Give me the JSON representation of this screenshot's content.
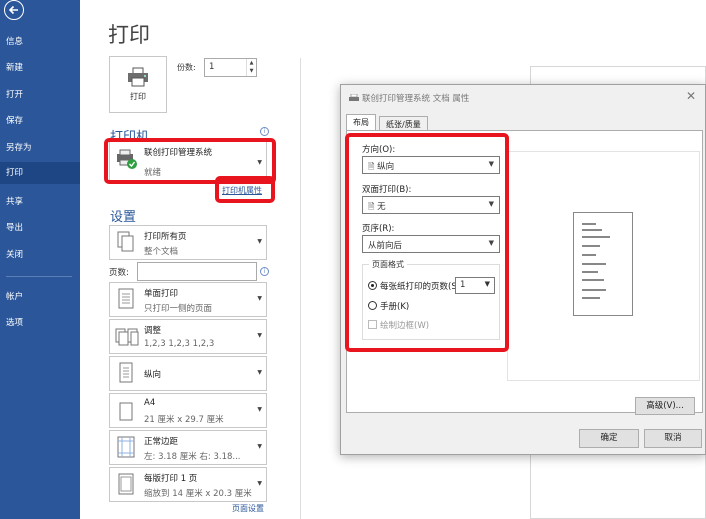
{
  "nav": {
    "items": [
      "信息",
      "新建",
      "打开",
      "保存",
      "另存为",
      "打印",
      "共享",
      "导出",
      "关闭",
      "帐户",
      "选项"
    ],
    "active": "打印"
  },
  "page": {
    "title": "打印"
  },
  "print_button": {
    "label": "打印"
  },
  "copies": {
    "label": "份数:",
    "value": "1"
  },
  "printer": {
    "heading": "打印机",
    "name": "联创打印管理系统",
    "status": "就绪",
    "properties_link": "打印机属性"
  },
  "settings": {
    "heading": "设置",
    "pages_label": "页数:",
    "pages_value": "",
    "items": [
      {
        "main": "打印所有页",
        "sub": "整个文档"
      },
      {
        "main": "单面打印",
        "sub": "只打印一侧的页面"
      },
      {
        "main": "调整",
        "sub": "1,2,3    1,2,3    1,2,3"
      },
      {
        "main": "纵向",
        "sub": ""
      },
      {
        "main": "A4",
        "sub": "21 厘米 x 29.7 厘米"
      },
      {
        "main": "正常边距",
        "sub": "左: 3.18 厘米    右: 3.18..."
      },
      {
        "main": "每版打印 1 页",
        "sub": "缩放到 14 厘米 x 20.3 厘米"
      }
    ],
    "page_setup_link": "页面设置"
  },
  "dialog": {
    "title": "联创打印管理系统 文档 属性",
    "tabs": [
      "布局",
      "纸张/质量"
    ],
    "active_tab": "布局",
    "orientation": {
      "label": "方向(O):",
      "value": "纵向"
    },
    "duplex": {
      "label": "双面打印(B):",
      "value": "无"
    },
    "page_order": {
      "label": "页序(R):",
      "value": "从前向后"
    },
    "page_format": {
      "title": "页面格式",
      "pages_per_sheet_label": "每张纸打印的页数(S)",
      "pages_per_sheet_value": "1",
      "booklet_label": "手册(K)",
      "borders_label": "绘制边框(W)"
    },
    "advanced_button": "高级(V)...",
    "ok_button": "确定",
    "cancel_button": "取消"
  },
  "colors": {
    "nav_bg": "#2b579a",
    "accent": "#2b579a",
    "highlight_frame": "#e8141e"
  }
}
